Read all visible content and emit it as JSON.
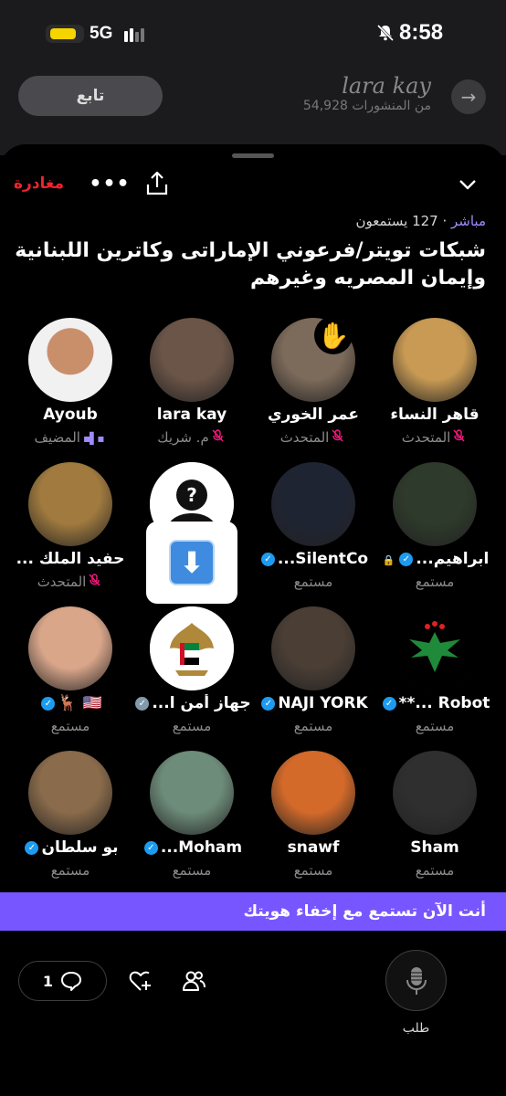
{
  "status_bar": {
    "network": "5G",
    "time": "8:58"
  },
  "background_profile": {
    "follow_label": "تابع",
    "name": "lara kay",
    "posts": "54,928 من المنشورات"
  },
  "header": {
    "leave_label": "مغادرة",
    "more_icon": "more-icon",
    "share_icon": "share-icon",
    "collapse_icon": "chevron-down-icon"
  },
  "space": {
    "live_label": "مباشر",
    "listeners": "127 يستمعون",
    "title": "شبكات تويتر/فرعوني الإماراتى وكاترين اللبنانية وإيمان المصريه وغيرهم"
  },
  "participants": [
    {
      "name": "Ayoub",
      "role": "المضيف",
      "badge": "speaking",
      "avatar_color": "#f1f1f1"
    },
    {
      "name": "lara kay",
      "role": "م. شريك",
      "badge": "muted",
      "avatar_color": "#6b5548"
    },
    {
      "name": "عمر الخوري",
      "role": "المتحدث",
      "badge": "muted",
      "avatar_color": "#7c6a5a",
      "hand_raised": true
    },
    {
      "name": "قاهر النساء",
      "role": "المتحدث",
      "badge": "muted",
      "avatar_color": "#c89a54"
    },
    {
      "name": "حفيد الملك ...",
      "role": "المتحدث",
      "badge": "muted",
      "avatar_color": "#a07a3e"
    },
    {
      "name": "",
      "role": "",
      "badge": "muted",
      "avatar_color": "#ffffff"
    },
    {
      "name": "SilentCo...",
      "role": "مستمع",
      "badge": "verified",
      "avatar_color": "#1f2433"
    },
    {
      "name": "ابراهيم...",
      "role": "مستمع",
      "badge": "verified-lock",
      "avatar_color": "#2e3a2b"
    },
    {
      "name": "🇺🇸 🦌",
      "role": "مستمع",
      "badge": "verified",
      "avatar_color": "#d9a68a"
    },
    {
      "name": "جهاز أمن ا...",
      "role": "مستمع",
      "badge": "verified-gray",
      "avatar_color": "#ffffff"
    },
    {
      "name": "NAJI YORK",
      "role": "مستمع",
      "badge": "verified",
      "avatar_color": "#4a3e35"
    },
    {
      "name": "Robot ...**",
      "role": "مستمع",
      "badge": "verified",
      "avatar_color": "#000000"
    },
    {
      "name": "بو سلطان",
      "role": "مستمع",
      "badge": "verified",
      "avatar_color": "#8a6b4b"
    },
    {
      "name": "Moham...",
      "role": "مستمع",
      "badge": "verified",
      "avatar_color": "#6e8c7a"
    },
    {
      "name": "snawf",
      "role": "مستمع",
      "badge": "none",
      "avatar_color": "#d46a2a"
    },
    {
      "name": "Sham",
      "role": "مستمع",
      "badge": "none",
      "avatar_color": "#2f2f2f"
    }
  ],
  "banner": {
    "text": "أنت الآن تستمع مع إخفاء هويتك"
  },
  "footer": {
    "comment_count": "1",
    "request_label": "طلب"
  }
}
